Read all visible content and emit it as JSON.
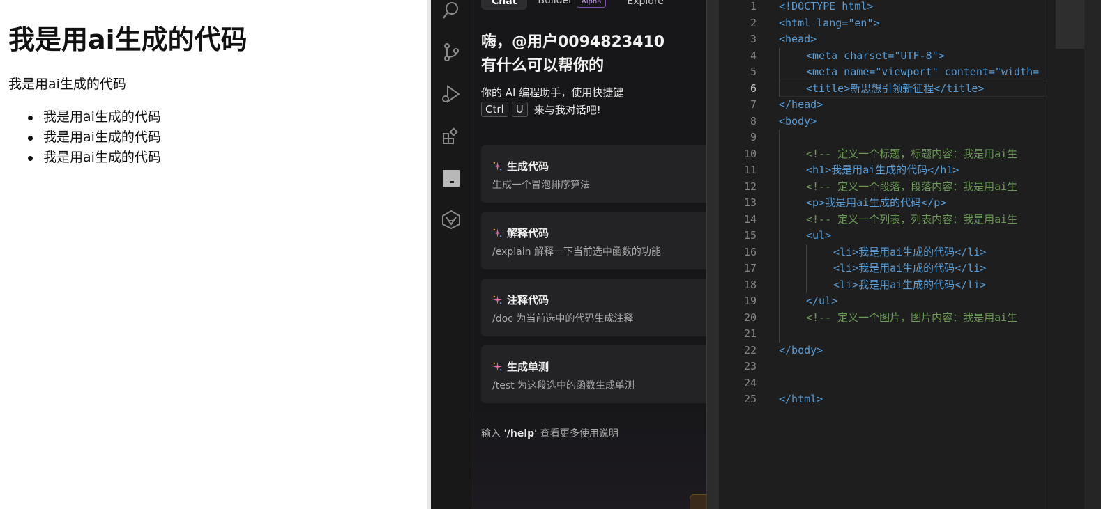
{
  "preview": {
    "heading": "我是用ai生成的代码",
    "paragraph": "我是用ai生成的代码",
    "list": [
      "我是用ai生成的代码",
      "我是用ai生成的代码",
      "我是用ai生成的代码"
    ]
  },
  "activity_bar": {
    "icons": [
      "search-icon",
      "source-control-icon",
      "run-debug-icon",
      "extensions-icon",
      "panel-icon",
      "ai-assistant-icon"
    ]
  },
  "chat": {
    "tabs": [
      {
        "label": "Chat",
        "active": true
      },
      {
        "label": "Builder",
        "badge": "Alpha"
      },
      {
        "label": "Explore"
      }
    ],
    "greeting_line1": "嗨，@用户0094823410",
    "greeting_line2": "有什么可以帮你的",
    "intro": "你的 AI 编程助手，使用快捷键",
    "key1": "Ctrl",
    "key2": "U",
    "key_suffix": "来与我对话吧!",
    "cards": [
      {
        "title": "生成代码",
        "desc": "生成一个冒泡排序算法"
      },
      {
        "title": "解释代码",
        "desc": "/explain 解释一下当前选中函数的功能"
      },
      {
        "title": "注释代码",
        "desc": "/doc 为当前选中的代码生成注释"
      },
      {
        "title": "生成单测",
        "desc": "/test 为这段选中的函数生成单测"
      }
    ],
    "help_prefix": "输入 ",
    "help_cmd": "'/help'",
    "help_suffix": " 查看更多使用说明"
  },
  "editor": {
    "line_numbers": [
      "1",
      "2",
      "3",
      "4",
      "5",
      "6",
      "7",
      "8",
      "9",
      "10",
      "11",
      "12",
      "13",
      "14",
      "15",
      "16",
      "17",
      "18",
      "19",
      "20",
      "21",
      "22",
      "23",
      "24",
      "25"
    ],
    "current_line": 6,
    "text": {
      "doctype": "<!DOCTYPE html>",
      "html_open": "<html lang=\"en\">",
      "head_open": "<head>",
      "meta_charset": "<meta charset=\"UTF-8\">",
      "meta_viewport": "<meta name=\"viewport\" content=\"width=",
      "title": "<title>新思想引领新征程</title>",
      "head_close": "</head>",
      "body_open": "<body>",
      "comment_h1": "<!-- 定义一个标题，标题内容：我是用ai生",
      "h1": "<h1>我是用ai生成的代码</h1>",
      "comment_p": "<!-- 定义一个段落，段落内容：我是用ai生",
      "p": "<p>我是用ai生成的代码</p>",
      "comment_ul": "<!-- 定义一个列表，列表内容：我是用ai生",
      "ul_open": "<ul>",
      "li": "<li>我是用ai生成的代码</li>",
      "ul_close": "</ul>",
      "comment_img": "<!-- 定义一个图片，图片内容：我是用ai生",
      "body_close": "</body>",
      "html_close": "</html>"
    }
  }
}
